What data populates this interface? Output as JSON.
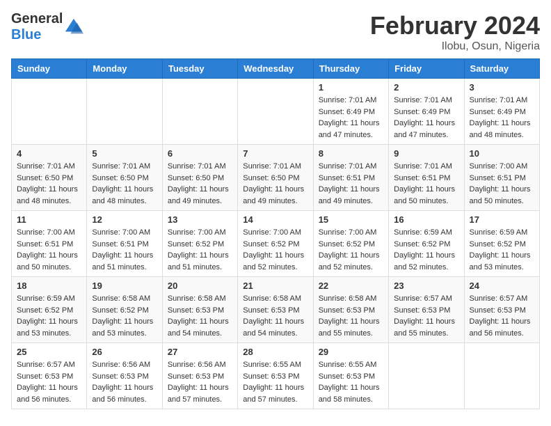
{
  "header": {
    "logo_general": "General",
    "logo_blue": "Blue",
    "month_year": "February 2024",
    "location": "Ilobu, Osun, Nigeria"
  },
  "weekdays": [
    "Sunday",
    "Monday",
    "Tuesday",
    "Wednesday",
    "Thursday",
    "Friday",
    "Saturday"
  ],
  "weeks": [
    [
      {
        "day": "",
        "sunrise": "",
        "sunset": "",
        "daylight": ""
      },
      {
        "day": "",
        "sunrise": "",
        "sunset": "",
        "daylight": ""
      },
      {
        "day": "",
        "sunrise": "",
        "sunset": "",
        "daylight": ""
      },
      {
        "day": "",
        "sunrise": "",
        "sunset": "",
        "daylight": ""
      },
      {
        "day": "1",
        "sunrise": "Sunrise: 7:01 AM",
        "sunset": "Sunset: 6:49 PM",
        "daylight": "Daylight: 11 hours and 47 minutes."
      },
      {
        "day": "2",
        "sunrise": "Sunrise: 7:01 AM",
        "sunset": "Sunset: 6:49 PM",
        "daylight": "Daylight: 11 hours and 47 minutes."
      },
      {
        "day": "3",
        "sunrise": "Sunrise: 7:01 AM",
        "sunset": "Sunset: 6:49 PM",
        "daylight": "Daylight: 11 hours and 48 minutes."
      }
    ],
    [
      {
        "day": "4",
        "sunrise": "Sunrise: 7:01 AM",
        "sunset": "Sunset: 6:50 PM",
        "daylight": "Daylight: 11 hours and 48 minutes."
      },
      {
        "day": "5",
        "sunrise": "Sunrise: 7:01 AM",
        "sunset": "Sunset: 6:50 PM",
        "daylight": "Daylight: 11 hours and 48 minutes."
      },
      {
        "day": "6",
        "sunrise": "Sunrise: 7:01 AM",
        "sunset": "Sunset: 6:50 PM",
        "daylight": "Daylight: 11 hours and 49 minutes."
      },
      {
        "day": "7",
        "sunrise": "Sunrise: 7:01 AM",
        "sunset": "Sunset: 6:50 PM",
        "daylight": "Daylight: 11 hours and 49 minutes."
      },
      {
        "day": "8",
        "sunrise": "Sunrise: 7:01 AM",
        "sunset": "Sunset: 6:51 PM",
        "daylight": "Daylight: 11 hours and 49 minutes."
      },
      {
        "day": "9",
        "sunrise": "Sunrise: 7:01 AM",
        "sunset": "Sunset: 6:51 PM",
        "daylight": "Daylight: 11 hours and 50 minutes."
      },
      {
        "day": "10",
        "sunrise": "Sunrise: 7:00 AM",
        "sunset": "Sunset: 6:51 PM",
        "daylight": "Daylight: 11 hours and 50 minutes."
      }
    ],
    [
      {
        "day": "11",
        "sunrise": "Sunrise: 7:00 AM",
        "sunset": "Sunset: 6:51 PM",
        "daylight": "Daylight: 11 hours and 50 minutes."
      },
      {
        "day": "12",
        "sunrise": "Sunrise: 7:00 AM",
        "sunset": "Sunset: 6:51 PM",
        "daylight": "Daylight: 11 hours and 51 minutes."
      },
      {
        "day": "13",
        "sunrise": "Sunrise: 7:00 AM",
        "sunset": "Sunset: 6:52 PM",
        "daylight": "Daylight: 11 hours and 51 minutes."
      },
      {
        "day": "14",
        "sunrise": "Sunrise: 7:00 AM",
        "sunset": "Sunset: 6:52 PM",
        "daylight": "Daylight: 11 hours and 52 minutes."
      },
      {
        "day": "15",
        "sunrise": "Sunrise: 7:00 AM",
        "sunset": "Sunset: 6:52 PM",
        "daylight": "Daylight: 11 hours and 52 minutes."
      },
      {
        "day": "16",
        "sunrise": "Sunrise: 6:59 AM",
        "sunset": "Sunset: 6:52 PM",
        "daylight": "Daylight: 11 hours and 52 minutes."
      },
      {
        "day": "17",
        "sunrise": "Sunrise: 6:59 AM",
        "sunset": "Sunset: 6:52 PM",
        "daylight": "Daylight: 11 hours and 53 minutes."
      }
    ],
    [
      {
        "day": "18",
        "sunrise": "Sunrise: 6:59 AM",
        "sunset": "Sunset: 6:52 PM",
        "daylight": "Daylight: 11 hours and 53 minutes."
      },
      {
        "day": "19",
        "sunrise": "Sunrise: 6:58 AM",
        "sunset": "Sunset: 6:52 PM",
        "daylight": "Daylight: 11 hours and 53 minutes."
      },
      {
        "day": "20",
        "sunrise": "Sunrise: 6:58 AM",
        "sunset": "Sunset: 6:53 PM",
        "daylight": "Daylight: 11 hours and 54 minutes."
      },
      {
        "day": "21",
        "sunrise": "Sunrise: 6:58 AM",
        "sunset": "Sunset: 6:53 PM",
        "daylight": "Daylight: 11 hours and 54 minutes."
      },
      {
        "day": "22",
        "sunrise": "Sunrise: 6:58 AM",
        "sunset": "Sunset: 6:53 PM",
        "daylight": "Daylight: 11 hours and 55 minutes."
      },
      {
        "day": "23",
        "sunrise": "Sunrise: 6:57 AM",
        "sunset": "Sunset: 6:53 PM",
        "daylight": "Daylight: 11 hours and 55 minutes."
      },
      {
        "day": "24",
        "sunrise": "Sunrise: 6:57 AM",
        "sunset": "Sunset: 6:53 PM",
        "daylight": "Daylight: 11 hours and 56 minutes."
      }
    ],
    [
      {
        "day": "25",
        "sunrise": "Sunrise: 6:57 AM",
        "sunset": "Sunset: 6:53 PM",
        "daylight": "Daylight: 11 hours and 56 minutes."
      },
      {
        "day": "26",
        "sunrise": "Sunrise: 6:56 AM",
        "sunset": "Sunset: 6:53 PM",
        "daylight": "Daylight: 11 hours and 56 minutes."
      },
      {
        "day": "27",
        "sunrise": "Sunrise: 6:56 AM",
        "sunset": "Sunset: 6:53 PM",
        "daylight": "Daylight: 11 hours and 57 minutes."
      },
      {
        "day": "28",
        "sunrise": "Sunrise: 6:55 AM",
        "sunset": "Sunset: 6:53 PM",
        "daylight": "Daylight: 11 hours and 57 minutes."
      },
      {
        "day": "29",
        "sunrise": "Sunrise: 6:55 AM",
        "sunset": "Sunset: 6:53 PM",
        "daylight": "Daylight: 11 hours and 58 minutes."
      },
      {
        "day": "",
        "sunrise": "",
        "sunset": "",
        "daylight": ""
      },
      {
        "day": "",
        "sunrise": "",
        "sunset": "",
        "daylight": ""
      }
    ]
  ]
}
